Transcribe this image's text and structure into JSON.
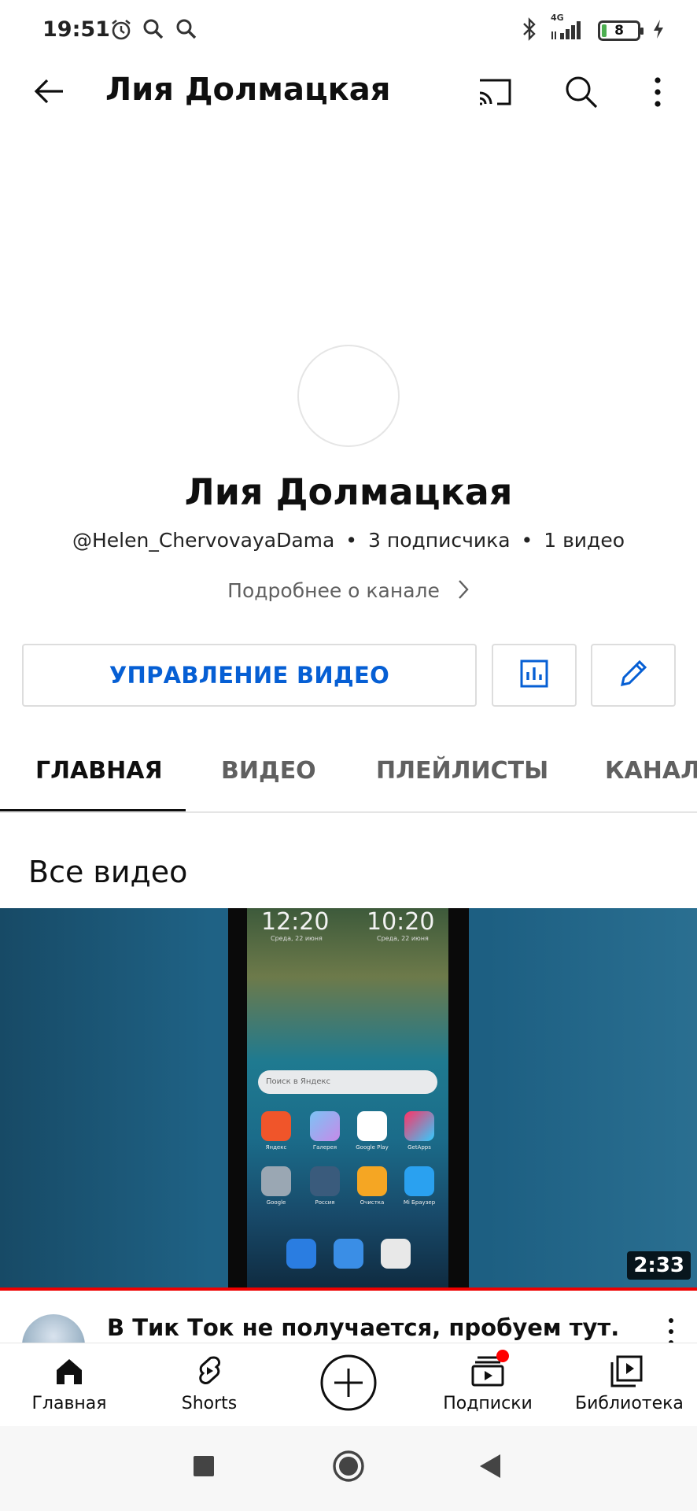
{
  "status": {
    "time": "19:51",
    "network": "4G",
    "battery": "8",
    "icons": [
      "alarm-icon",
      "search-icon",
      "search-icon",
      "bluetooth-icon",
      "signal-icon",
      "battery-icon",
      "charging-icon"
    ]
  },
  "appbar": {
    "title": "Лия Долмацкая",
    "icons": [
      "back-arrow-icon",
      "cast-icon",
      "search-icon",
      "more-vert-icon"
    ]
  },
  "channel": {
    "name": "Лия Долмацкая",
    "handle": "@Helen_ChervovayaDama",
    "subscribers": "3 подписчика",
    "videos": "1 видео",
    "separator": "•",
    "more_link": "Подробнее о канале"
  },
  "actions": {
    "manage_label": "УПРАВЛЕНИЕ ВИДЕО",
    "stats_icon": "analytics-icon",
    "edit_icon": "edit-pencil-icon",
    "accent": "#065fd4"
  },
  "tabs": [
    {
      "label": "ГЛАВНАЯ",
      "active": true
    },
    {
      "label": "ВИДЕО",
      "active": false
    },
    {
      "label": "ПЛЕЙЛИСТЫ",
      "active": false
    },
    {
      "label": "КАНАЛЫ",
      "active": false
    }
  ],
  "section": {
    "title": "Все видео"
  },
  "video": {
    "duration": "2:33",
    "title": "В Тик Ток не получается, пробуем тут. Это",
    "progress_color": "#ee0000",
    "thumbnail": {
      "clock_left": "12:20",
      "clock_right": "10:20",
      "date_left": "Среда, 22 июня",
      "date_right": "Среда, 22 июня",
      "search_placeholder": "Поиск в Яндекс",
      "apps": [
        "Яндекс",
        "Галерея",
        "Google Play",
        "GetApps",
        "Google",
        "Россия",
        "Очистка",
        "Mi Браузер"
      ]
    }
  },
  "bottom_nav": [
    {
      "label": "Главная",
      "icon": "home-icon"
    },
    {
      "label": "Shorts",
      "icon": "shorts-icon"
    },
    {
      "label": "",
      "icon": "create-plus-icon"
    },
    {
      "label": "Подписки",
      "icon": "subscriptions-icon",
      "badge": true
    },
    {
      "label": "Библиотека",
      "icon": "library-icon"
    }
  ],
  "system_nav": [
    "recents-square-icon",
    "home-circle-icon",
    "back-triangle-icon"
  ]
}
